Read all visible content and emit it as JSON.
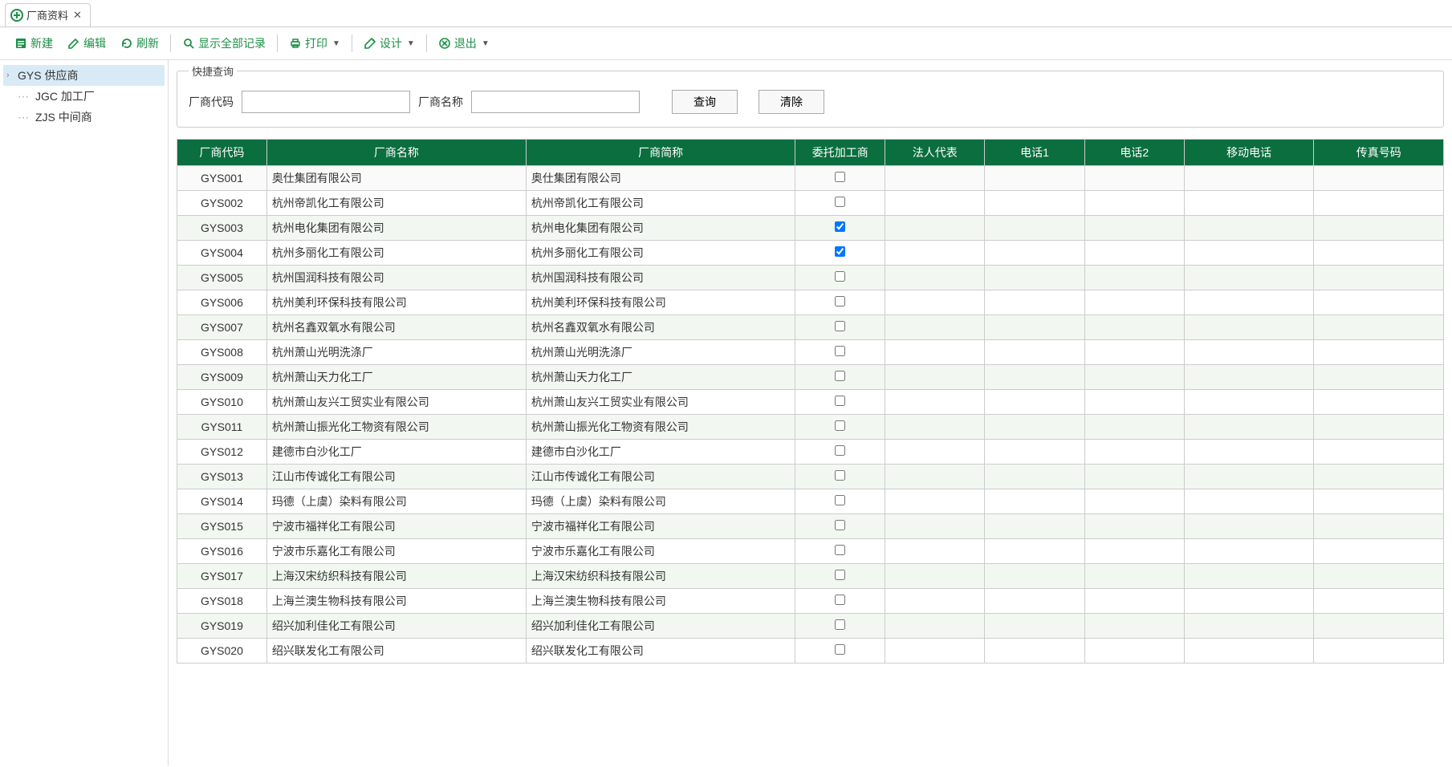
{
  "tab": {
    "title": "厂商资料"
  },
  "toolbar": {
    "new": "新建",
    "edit": "编辑",
    "refresh": "刷新",
    "show_all": "显示全部记录",
    "print": "打印",
    "design": "设计",
    "exit": "退出"
  },
  "tree": {
    "items": [
      {
        "code": "GYS",
        "label": "GYS 供应商",
        "selected": true,
        "expandable": true
      },
      {
        "code": "JGC",
        "label": "JGC 加工厂",
        "leaf": true
      },
      {
        "code": "ZJS",
        "label": "ZJS 中间商",
        "leaf": true
      }
    ]
  },
  "search": {
    "legend": "快捷查询",
    "code_label": "厂商代码",
    "name_label": "厂商名称",
    "query_btn": "查询",
    "clear_btn": "清除"
  },
  "table": {
    "columns": [
      "厂商代码",
      "厂商名称",
      "厂商简称",
      "委托加工商",
      "法人代表",
      "电话1",
      "电话2",
      "移动电话",
      "传真号码"
    ],
    "rows": [
      {
        "code": "GYS001",
        "name": "奥仕集团有限公司",
        "short": "奥仕集团有限公司",
        "oem": false,
        "legal": "",
        "tel1": "",
        "tel2": "",
        "mobile": "",
        "fax": "",
        "selected": true
      },
      {
        "code": "GYS002",
        "name": "杭州帝凯化工有限公司",
        "short": "杭州帝凯化工有限公司",
        "oem": false,
        "legal": "",
        "tel1": "",
        "tel2": "",
        "mobile": "",
        "fax": ""
      },
      {
        "code": "GYS003",
        "name": "杭州电化集团有限公司",
        "short": "杭州电化集团有限公司",
        "oem": true,
        "legal": "",
        "tel1": "",
        "tel2": "",
        "mobile": "",
        "fax": ""
      },
      {
        "code": "GYS004",
        "name": "杭州多丽化工有限公司",
        "short": "杭州多丽化工有限公司",
        "oem": true,
        "legal": "",
        "tel1": "",
        "tel2": "",
        "mobile": "",
        "fax": ""
      },
      {
        "code": "GYS005",
        "name": "杭州国润科技有限公司",
        "short": "杭州国润科技有限公司",
        "oem": false,
        "legal": "",
        "tel1": "",
        "tel2": "",
        "mobile": "",
        "fax": ""
      },
      {
        "code": "GYS006",
        "name": "杭州美利环保科技有限公司",
        "short": "杭州美利环保科技有限公司",
        "oem": false,
        "legal": "",
        "tel1": "",
        "tel2": "",
        "mobile": "",
        "fax": ""
      },
      {
        "code": "GYS007",
        "name": "杭州名鑫双氧水有限公司",
        "short": "杭州名鑫双氧水有限公司",
        "oem": false,
        "legal": "",
        "tel1": "",
        "tel2": "",
        "mobile": "",
        "fax": ""
      },
      {
        "code": "GYS008",
        "name": "杭州萧山光明洗涤厂",
        "short": "杭州萧山光明洗涤厂",
        "oem": false,
        "legal": "",
        "tel1": "",
        "tel2": "",
        "mobile": "",
        "fax": ""
      },
      {
        "code": "GYS009",
        "name": "杭州萧山天力化工厂",
        "short": "杭州萧山天力化工厂",
        "oem": false,
        "legal": "",
        "tel1": "",
        "tel2": "",
        "mobile": "",
        "fax": ""
      },
      {
        "code": "GYS010",
        "name": "杭州萧山友兴工贸实业有限公司",
        "short": "杭州萧山友兴工贸实业有限公司",
        "oem": false,
        "legal": "",
        "tel1": "",
        "tel2": "",
        "mobile": "",
        "fax": ""
      },
      {
        "code": "GYS011",
        "name": "杭州萧山振光化工物资有限公司",
        "short": "杭州萧山振光化工物资有限公司",
        "oem": false,
        "legal": "",
        "tel1": "",
        "tel2": "",
        "mobile": "",
        "fax": ""
      },
      {
        "code": "GYS012",
        "name": "建德市白沙化工厂",
        "short": "建德市白沙化工厂",
        "oem": false,
        "legal": "",
        "tel1": "",
        "tel2": "",
        "mobile": "",
        "fax": ""
      },
      {
        "code": "GYS013",
        "name": "江山市传诚化工有限公司",
        "short": "江山市传诚化工有限公司",
        "oem": false,
        "legal": "",
        "tel1": "",
        "tel2": "",
        "mobile": "",
        "fax": ""
      },
      {
        "code": "GYS014",
        "name": "玛德（上虞）染料有限公司",
        "short": "玛德（上虞）染料有限公司",
        "oem": false,
        "legal": "",
        "tel1": "",
        "tel2": "",
        "mobile": "",
        "fax": ""
      },
      {
        "code": "GYS015",
        "name": "宁波市福祥化工有限公司",
        "short": "宁波市福祥化工有限公司",
        "oem": false,
        "legal": "",
        "tel1": "",
        "tel2": "",
        "mobile": "",
        "fax": ""
      },
      {
        "code": "GYS016",
        "name": "宁波市乐嘉化工有限公司",
        "short": "宁波市乐嘉化工有限公司",
        "oem": false,
        "legal": "",
        "tel1": "",
        "tel2": "",
        "mobile": "",
        "fax": ""
      },
      {
        "code": "GYS017",
        "name": "上海汉宋纺织科技有限公司",
        "short": "上海汉宋纺织科技有限公司",
        "oem": false,
        "legal": "",
        "tel1": "",
        "tel2": "",
        "mobile": "",
        "fax": ""
      },
      {
        "code": "GYS018",
        "name": "上海兰澳生物科技有限公司",
        "short": "上海兰澳生物科技有限公司",
        "oem": false,
        "legal": "",
        "tel1": "",
        "tel2": "",
        "mobile": "",
        "fax": ""
      },
      {
        "code": "GYS019",
        "name": "绍兴加利佳化工有限公司",
        "short": "绍兴加利佳化工有限公司",
        "oem": false,
        "legal": "",
        "tel1": "",
        "tel2": "",
        "mobile": "",
        "fax": ""
      },
      {
        "code": "GYS020",
        "name": "绍兴联发化工有限公司",
        "short": "绍兴联发化工有限公司",
        "oem": false,
        "legal": "",
        "tel1": "",
        "tel2": "",
        "mobile": "",
        "fax": ""
      }
    ]
  }
}
